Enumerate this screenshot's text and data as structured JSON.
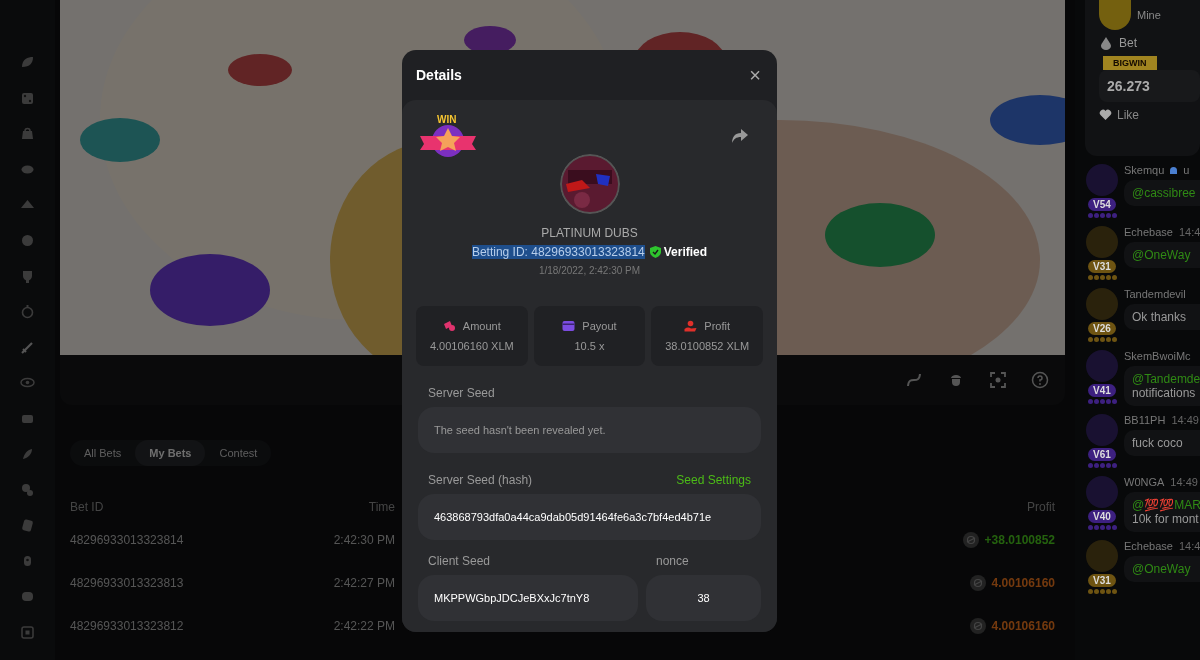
{
  "bet_tabs": [
    {
      "label": "All Bets",
      "selected": false
    },
    {
      "label": "My Bets",
      "selected": true
    },
    {
      "label": "Contest",
      "selected": false
    }
  ],
  "bets_table": {
    "columns": [
      "Bet ID",
      "Time",
      "Profit"
    ],
    "rows": [
      {
        "bet_id": "48296933013323814",
        "time": "2:42:30 PM",
        "profit": "+38.0100852",
        "kind": "win"
      },
      {
        "bet_id": "48296933013323813",
        "time": "2:42:27 PM",
        "profit": "4.00106160",
        "kind": "loss"
      },
      {
        "bet_id": "48296933013323812",
        "time": "2:42:22 PM",
        "profit": "4.00106160",
        "kind": "loss"
      }
    ]
  },
  "chat": {
    "feature_card": {
      "subtitle": "Mine",
      "bet_label": "Bet",
      "banner": "BIGWIN",
      "amount": "26.273",
      "like": "Like"
    },
    "messages": [
      {
        "name": "Skemqu",
        "tag": "u",
        "level": "V54",
        "color": "#3d2080",
        "mention": "@cassibree"
      },
      {
        "name": "Echebase",
        "time": "14:4",
        "level": "V31",
        "color": "#6e5412",
        "mention": "@OneWay"
      },
      {
        "name": "Tandemdevil",
        "level": "V26",
        "color": "#6e5412",
        "text": "Ok thanks"
      },
      {
        "name": "SkemBwoiMc",
        "level": "V41",
        "color": "#3d2080",
        "mention": "@Tandemde",
        "text": "notifications"
      },
      {
        "name": "BB11PH",
        "time": "14:49",
        "level": "V61",
        "color": "#3d2080",
        "text": "fuck coco"
      },
      {
        "name": "W0NGA",
        "time": "14:49",
        "level": "V40",
        "color": "#3d2080",
        "mention": "@💯💯MAR",
        "text": "10k for mont"
      },
      {
        "name": "Echebase",
        "time": "14:4",
        "level": "V31",
        "color": "#6e5412",
        "mention": "@OneWay"
      }
    ]
  },
  "details": {
    "title": "Details",
    "close": "×",
    "badge": "WIN",
    "username": "PLATINUM DUBS",
    "betting_id": "Betting ID: 48296933013323814",
    "highlighted": true,
    "verified": "Verified",
    "date": "1/18/2022, 2:42:30 PM",
    "stats": [
      {
        "kind": "amount",
        "label": "Amount",
        "value": "4.00106160 XLM"
      },
      {
        "kind": "payout",
        "label": "Payout",
        "value": "10.5 x"
      },
      {
        "kind": "profit",
        "label": "Profit",
        "value": "38.0100852 XLM"
      }
    ],
    "server_seed": {
      "label": "Server Seed",
      "message": "The seed hasn't been revealed yet."
    },
    "server_seed_hash": {
      "label": "Server Seed (hash)",
      "link": "Seed Settings",
      "value": "463868793dfa0a44ca9dab05d91464fe6a3c7bf4ed4b71e"
    },
    "client_seed": {
      "label": "Client Seed",
      "value": "MKPPWGbpJDCJeBXxJc7tnY8"
    },
    "nonce": {
      "label": "nonce",
      "value": "38"
    }
  }
}
